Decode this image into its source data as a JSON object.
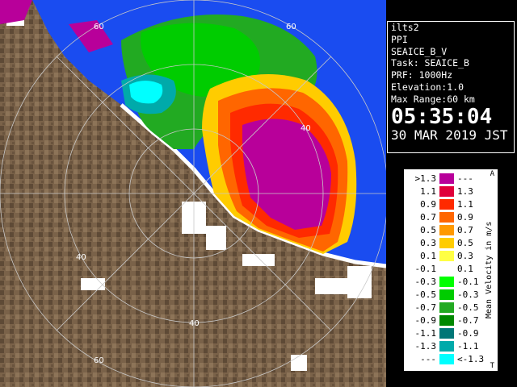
{
  "station": {
    "id": "ilts2",
    "product": "PPI",
    "scan": "SEAICE_B_V",
    "task": "Task: SEAICE_B",
    "prf": "PRF: 1000Hz",
    "elevation": "Elevation:1.0",
    "max_range": "Max Range:60 km",
    "time": "05:35:04",
    "date": "30 MAR 2019 JST"
  },
  "legend": {
    "title": "Mean Velocity in m/s",
    "top_mark": "A",
    "bottom_mark": "T",
    "rows": [
      {
        "lo": ">1.3",
        "hi": "---",
        "color": "#b8009a"
      },
      {
        "lo": "1.1",
        "hi": "1.3",
        "color": "#e0003a"
      },
      {
        "lo": "0.9",
        "hi": "1.1",
        "color": "#ff2a00"
      },
      {
        "lo": "0.7",
        "hi": "0.9",
        "color": "#ff6600"
      },
      {
        "lo": "0.5",
        "hi": "0.7",
        "color": "#ff9900"
      },
      {
        "lo": "0.3",
        "hi": "0.5",
        "color": "#ffcc00"
      },
      {
        "lo": "0.1",
        "hi": "0.3",
        "color": "#ffff44"
      },
      {
        "lo": "-0.1",
        "hi": "0.1",
        "color": "#ffffff"
      },
      {
        "lo": "-0.3",
        "hi": "-0.1",
        "color": "#00ff00"
      },
      {
        "lo": "-0.5",
        "hi": "-0.3",
        "color": "#00cc00"
      },
      {
        "lo": "-0.7",
        "hi": "-0.5",
        "color": "#22aa22"
      },
      {
        "lo": "-0.9",
        "hi": "-0.7",
        "color": "#008800"
      },
      {
        "lo": "-1.1",
        "hi": "-0.9",
        "color": "#007777"
      },
      {
        "lo": "-1.3",
        "hi": "-1.1",
        "color": "#00aaaa"
      },
      {
        "lo": "---",
        "hi": "<-1.3",
        "color": "#00ffff"
      }
    ]
  },
  "range_labels": [
    "60",
    "60",
    "40",
    "40",
    "40",
    "60"
  ],
  "colors": {
    "sea": "#1a4cf0",
    "land": "#7a6249",
    "land_dark": "#5e4a36",
    "snow": "#ffffff",
    "grid": "#c8c8c8",
    "rivers": "#6a78d8",
    "roads": "#c03a2a"
  }
}
